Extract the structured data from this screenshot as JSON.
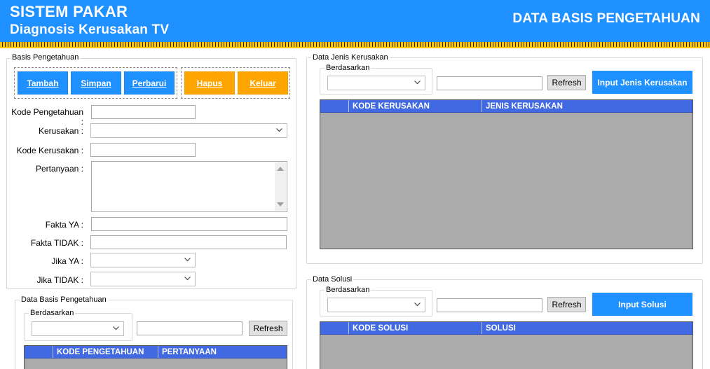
{
  "header": {
    "app_title": "SISTEM PAKAR",
    "app_subtitle": "Diagnosis Kerusakan TV",
    "page_title": "DATA BASIS PENGETAHUAN",
    "colors": {
      "primary": "#1e90ff",
      "accent": "#ffa500",
      "grid_header": "#4169e1"
    }
  },
  "basis_form": {
    "legend": "Basis Pengetahuan",
    "buttons": {
      "tambah": "Tambah",
      "simpan": "Simpan",
      "perbarui": "Perbarui",
      "hapus": "Hapus",
      "keluar": "Keluar"
    },
    "labels": {
      "kode_pengetahuan": "Kode Pengetahuan :",
      "kerusakan": "Kerusakan :",
      "kode_kerusakan": "Kode Kerusakan :",
      "pertanyaan": "Pertanyaan :",
      "fakta_ya": "Fakta YA :",
      "fakta_tidak": "Fakta TIDAK :",
      "jika_ya": "Jika YA :",
      "jika_tidak": "Jika TIDAK :"
    },
    "values": {
      "kode_pengetahuan": "",
      "kerusakan": "",
      "kode_kerusakan": "",
      "pertanyaan": "",
      "fakta_ya": "",
      "fakta_tidak": "",
      "jika_ya": "",
      "jika_tidak": ""
    }
  },
  "data_basis": {
    "legend": "Data Basis Pengetahuan",
    "filter_legend": "Berdasarkan",
    "search_value": "",
    "refresh": "Refresh",
    "columns": [
      "KODE PENGETAHUAN",
      "PERTANYAAN"
    ]
  },
  "data_jenis": {
    "legend": "Data Jenis Kerusakan",
    "filter_legend": "Berdasarkan",
    "search_value": "",
    "refresh": "Refresh",
    "input_button": "Input Jenis Kerusakan",
    "columns": [
      "KODE KERUSAKAN",
      "JENIS KERUSAKAN"
    ]
  },
  "data_solusi": {
    "legend": "Data Solusi",
    "filter_legend": "Berdasarkan",
    "search_value": "",
    "refresh": "Refresh",
    "input_button": "Input Solusi",
    "columns": [
      "KODE SOLUSI",
      "SOLUSI"
    ]
  },
  "icons": [
    "chevron-down-icon",
    "scroll-up-icon",
    "scroll-down-icon"
  ]
}
